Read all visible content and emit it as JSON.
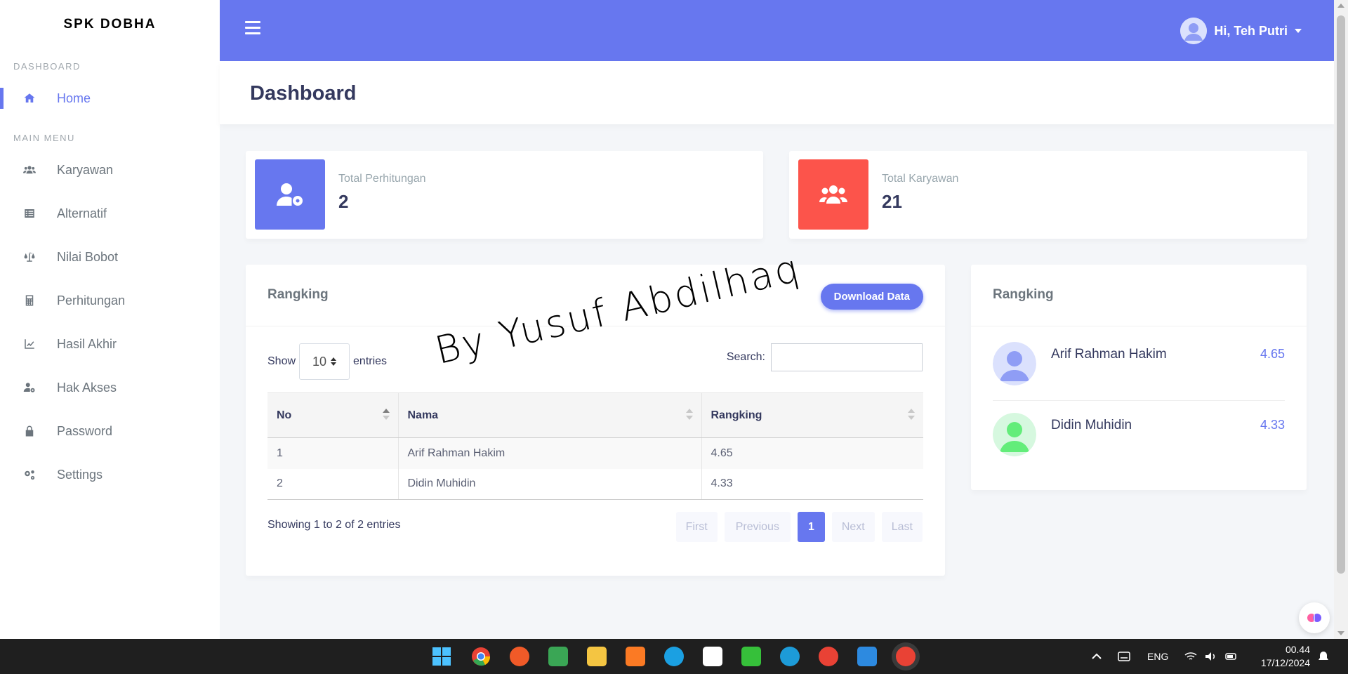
{
  "app": {
    "brand": "SPK DOBHA",
    "accent": "#6777ef",
    "danger": "#fc544b"
  },
  "sidebar": {
    "sections": [
      {
        "header": "DASHBOARD"
      },
      {
        "header": "MAIN MENU"
      }
    ],
    "items": [
      {
        "label": "Home",
        "icon": "home-icon",
        "active": true
      },
      {
        "label": "Karyawan",
        "icon": "users-icon"
      },
      {
        "label": "Alternatif",
        "icon": "list-icon"
      },
      {
        "label": "Nilai Bobot",
        "icon": "balance-scale-icon"
      },
      {
        "label": "Perhitungan",
        "icon": "calculator-icon"
      },
      {
        "label": "Hasil Akhir",
        "icon": "chart-line-icon"
      },
      {
        "label": "Hak Akses",
        "icon": "user-cog-icon"
      },
      {
        "label": "Password",
        "icon": "lock-icon"
      },
      {
        "label": "Settings",
        "icon": "cogs-icon"
      }
    ]
  },
  "navbar": {
    "greeting": "Hi, Teh Putri"
  },
  "page": {
    "title": "Dashboard"
  },
  "stats": [
    {
      "label": "Total Perhitungan",
      "value": "2",
      "icon": "user-cog-icon",
      "color": "#6777ef"
    },
    {
      "label": "Total Karyawan",
      "value": "21",
      "icon": "users-icon",
      "color": "#fc544b"
    }
  ],
  "ranking_table": {
    "title": "Rangking",
    "download_label": "Download Data",
    "show_label": "Show",
    "entries_label": "entries",
    "page_length": "10",
    "search_label": "Search:",
    "search_value": "",
    "columns": [
      "No",
      "Nama",
      "Rangking"
    ],
    "rows": [
      [
        "1",
        "Arif Rahman Hakim",
        "4.65"
      ],
      [
        "2",
        "Didin Muhidin",
        "4.33"
      ]
    ],
    "info": "Showing 1 to 2 of 2 entries",
    "pagination": [
      "First",
      "Previous",
      "1",
      "Next",
      "Last"
    ],
    "current_page": "1"
  },
  "ranking_list": {
    "title": "Rangking",
    "items": [
      {
        "name": "Arif Rahman Hakim",
        "score": "4.65",
        "avatar_color": "#dbe1fd"
      },
      {
        "name": "Didin Muhidin",
        "score": "4.33",
        "avatar_color": "#d6f8df"
      }
    ]
  },
  "watermark": "By Yusuf Abdilhaq",
  "taskbar": {
    "language": "ENG",
    "time": "00.44",
    "date": "17/12/2024",
    "apps": [
      "windows-start-icon",
      "chrome-icon",
      "pen-app-icon",
      "owl-app-icon",
      "file-explorer-icon",
      "xampp-icon",
      "mysql-icon",
      "capcut-icon",
      "notepad-plus-icon",
      "edge-icon",
      "chrome-profile-icon",
      "vscode-icon",
      "chrome-active-icon"
    ]
  }
}
